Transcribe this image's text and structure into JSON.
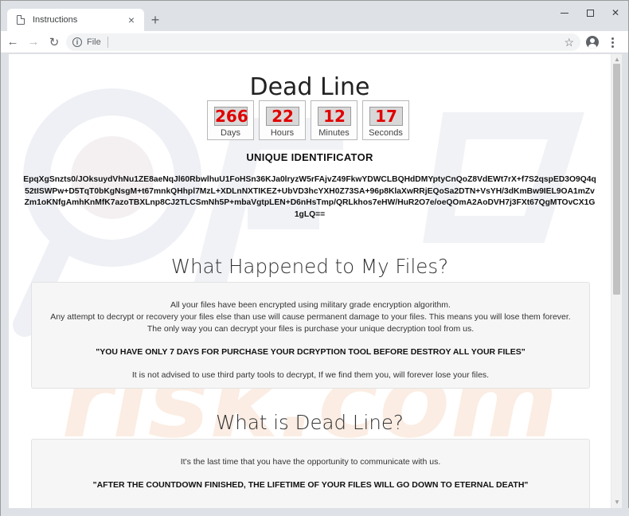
{
  "browser": {
    "tab_title": "Instructions",
    "omnibox_scheme": "File",
    "omnibox_url": "",
    "tab_close_glyph": "×",
    "new_tab_glyph": "+",
    "back_glyph": "←",
    "forward_glyph": "→",
    "reload_glyph": "↻",
    "info_glyph": "i",
    "star_glyph": "☆",
    "close_glyph": "✕",
    "scroll_up_glyph": "▲",
    "scroll_down_glyph": "▼"
  },
  "page": {
    "title": "Dead Line",
    "countdown": {
      "days": "266",
      "days_label": "Days",
      "hours": "22",
      "hours_label": "Hours",
      "minutes": "12",
      "minutes_label": "Minutes",
      "seconds": "17",
      "seconds_label": "Seconds"
    },
    "uid_title": "UNIQUE IDENTIFICATOR",
    "uid_value": "EpqXgSnzts0/JOksuydVhNu1ZE8aeNqJl60RbwlhuU1FoHSn36KJa0lryzW5rFAjvZ49FkwYDWCLBQHdDMYptyCnQoZ8VdEWt7rX+f7S2qspED3O9Q4q52tISWPw+D5TqT0bKgNsgM+t67mnkQHhpl7MzL+XDLnNXTIKEZ+UbVD3hcYXH0Z73SA+96p8KlaXwRRjEQoSa2DTN+VsYH/3dKmBw9IEL9OA1mZvZm1oKNfgAmhKnMfK7azoTBXLnp8CJ2TLCSmNh5P+mbaVgtpLEN+D6nHsTmp/QRLkhos7eHW/HuR2O7e/oeQOmA2AoDVH7j3FXt67QgMTOvCX1G1gLQ==",
    "section1_title": "What Happened to My Files?",
    "section1": {
      "line1": "All your files have been encrypted using military grade encryption algorithm.",
      "line2": "Any attempt to decrypt or recovery your files else than use will cause permanent damage to your files. This means you will lose them forever.",
      "line3": "The only way you can decrypt your files is purchase your unique decryption tool from us.",
      "warning": "\"YOU HAVE ONLY 7 DAYS FOR PURCHASE YOUR DCRYPTION TOOL BEFORE DESTROY ALL YOUR FILES\"",
      "line4": "It is not advised to use third party tools to decrypt, If we find them you, will forever lose your files."
    },
    "section2_title": "What is Dead Line?",
    "section2": {
      "line1": "It's the last time that you have the opportunity to communicate with us.",
      "warning": "\"AFTER THE COUNTDOWN FINISHED, THE LIFETIME OF YOUR FILES WILL GO DOWN TO ETERNAL DEATH\""
    },
    "watermark_text": "risk.com"
  },
  "colors": {
    "countdown_red": "#e00000",
    "watermark": "#f2c7a6"
  }
}
